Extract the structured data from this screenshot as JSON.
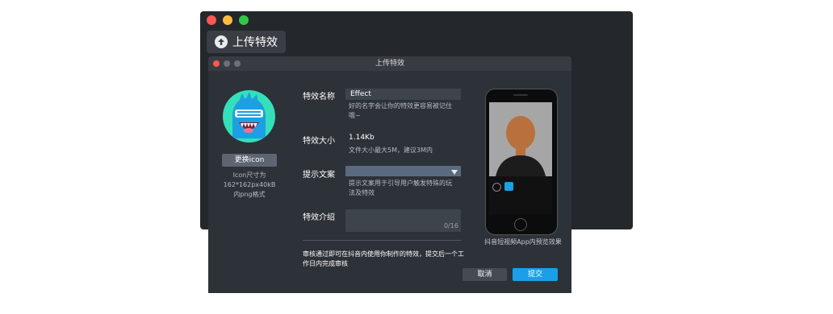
{
  "colors": {
    "traffic_red": "#fc5753",
    "traffic_yellow": "#fdbc40",
    "traffic_green": "#33c748",
    "dialog_bg": "#2d3238",
    "primary_button": "#1aa0e6",
    "avatar_bg": "#34e0b9"
  },
  "back_window": {
    "upload_button_label": "上传特效"
  },
  "dialog": {
    "title": "上传特效",
    "icon_section": {
      "change_icon_label": "更换icon",
      "icon_hint": "Icon尺寸为\n162*162px40kB\n内png格式"
    },
    "form": {
      "name_label": "特效名称",
      "name_value": "Effect",
      "name_hint": "好的名字会让你的特效更容易被记住\n哦~",
      "size_label": "特效大小",
      "size_value": "1.14Kb",
      "size_hint": "文件大小最大5M，建议3M内",
      "tip_label": "提示文案",
      "tip_value": "",
      "tip_hint": "提示文案用于引导用户触发特殊的玩\n法及特效",
      "intro_label": "特效介绍",
      "intro_value": "",
      "intro_counter": "0/16"
    },
    "notice": "审核通过即可在抖音内使用你制作的特效，提交后一个工作日内完成审核",
    "cancel_label": "取消",
    "submit_label": "提交",
    "preview_caption": "抖音短视频App内预览效果"
  }
}
